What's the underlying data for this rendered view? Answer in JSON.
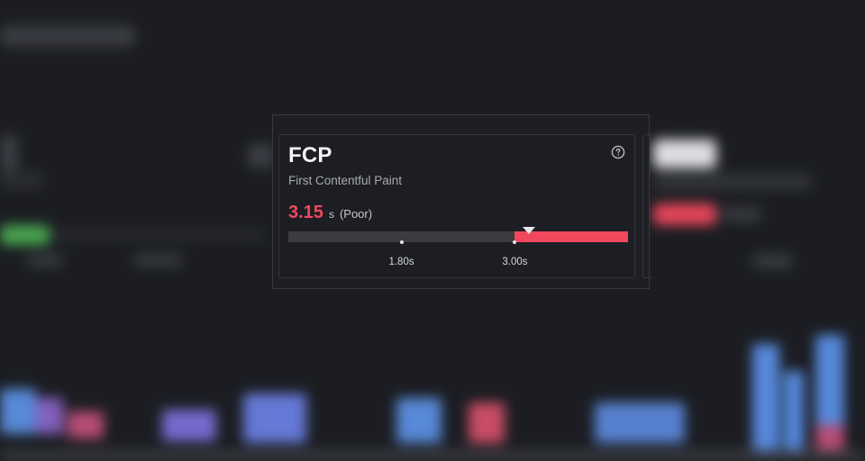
{
  "card": {
    "title": "FCP",
    "subtitle": "First Contentful Paint",
    "value": "3.15",
    "unit": "s",
    "rating": "(Poor)",
    "help_icon": "question-circle-icon"
  },
  "scale": {
    "thresholds": [
      {
        "value": 1.8,
        "label": "1.80s"
      },
      {
        "value": 3.0,
        "label": "3.00s"
      }
    ],
    "current": 3.15,
    "poor_fraction_start": 0.667
  },
  "colors": {
    "poor": "#f2485e",
    "track": "#3a3c41",
    "background": "#1b1d22"
  }
}
